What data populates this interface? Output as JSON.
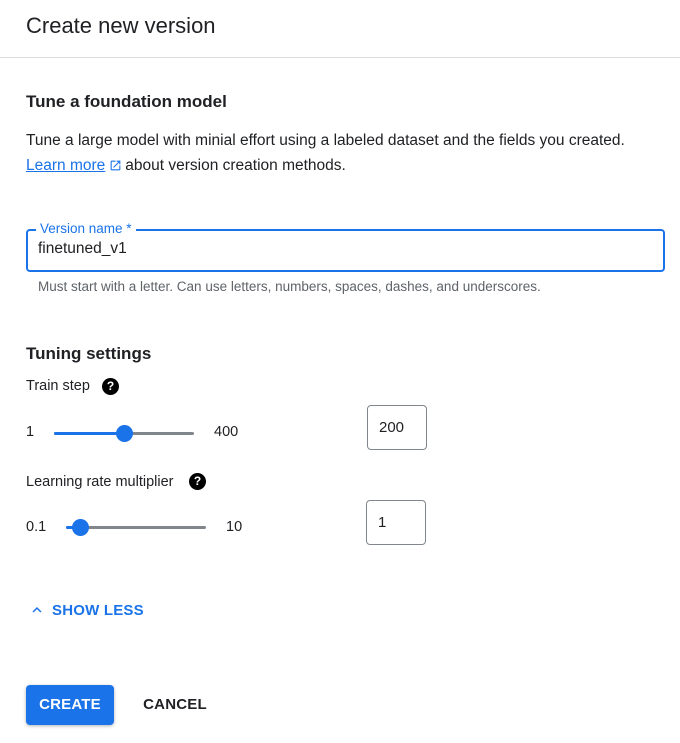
{
  "dialog": {
    "title": "Create new version"
  },
  "tune": {
    "heading": "Tune a foundation model",
    "description_line1": "Tune a large model with minial effort using a labeled dataset and the fields you created.",
    "learn_more_label": "Learn more",
    "description_line2": "about version creation methods."
  },
  "version_name": {
    "label": "Version name *",
    "value": "finetuned_v1",
    "hint": "Must start with a letter. Can use letters, numbers, spaces, dashes, and underscores."
  },
  "tuning": {
    "heading": "Tuning settings",
    "train_step": {
      "label": "Train step",
      "help": "?",
      "min": "1",
      "max": "400",
      "value": "200",
      "slider_fraction": 0.5
    },
    "learning_rate": {
      "label": "Learning rate multiplier",
      "help": "?",
      "min": "0.1",
      "max": "10",
      "value": "1",
      "slider_fraction": 0.1
    }
  },
  "toggle": {
    "label": "SHOW LESS",
    "icon": "chevron-up-icon"
  },
  "actions": {
    "create_label": "CREATE",
    "cancel_label": "CANCEL"
  },
  "colors": {
    "accent": "#1a73e8",
    "text": "#202124",
    "hint": "#5f6368",
    "border": "#dadce0"
  }
}
